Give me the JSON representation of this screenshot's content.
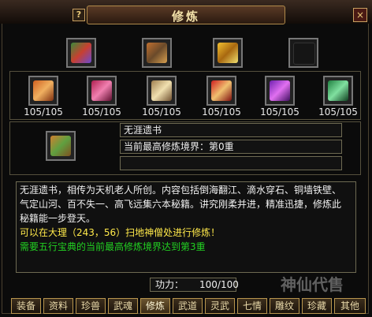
{
  "window": {
    "title": "修炼",
    "help": "?",
    "close": "×"
  },
  "icons": {
    "top": [
      "book-icon",
      "scroll-icon",
      "gold-chest-icon",
      "empty-slot-icon"
    ],
    "row": [
      "orange-scroll-icon",
      "pink-scroll-icon",
      "gold-scroll-icon",
      "red-scroll-icon",
      "purple-scroll-icon",
      "green-scroll-icon"
    ]
  },
  "row_counts": [
    "105/105",
    "105/105",
    "105/105",
    "105/105",
    "105/105",
    "105/105"
  ],
  "selected": {
    "name": "无涯遗书",
    "level": "当前最高修炼境界：第0重",
    "empty": ""
  },
  "description": {
    "line1": "无涯遗书，相传为天机老人所创。内容包括倒海翻江、滴水穿石、铜墙铁壁、",
    "line2": "气定山河、百不失一、高飞远集六本秘籍。讲究刚柔并进，精准迅捷，修炼此",
    "line3": "秘籍能一步登天。",
    "line4": "可以在大理（243，56）扫地神僧处进行修炼！",
    "line5": "需要五行宝典的当前最高修炼境界达到第3重"
  },
  "power": {
    "label": "功力：",
    "value": "100/100"
  },
  "tabs": [
    "装备",
    "资料",
    "珍兽",
    "武魂",
    "修炼",
    "武道",
    "灵武",
    "七情",
    "雕纹",
    "珍藏",
    "其他"
  ],
  "active_tab": "修炼",
  "watermark": "神仙代售",
  "colors": {
    "text_yellow": "#ffe94a",
    "text_green": "#22d022",
    "text_white": "#f0f0f0"
  }
}
